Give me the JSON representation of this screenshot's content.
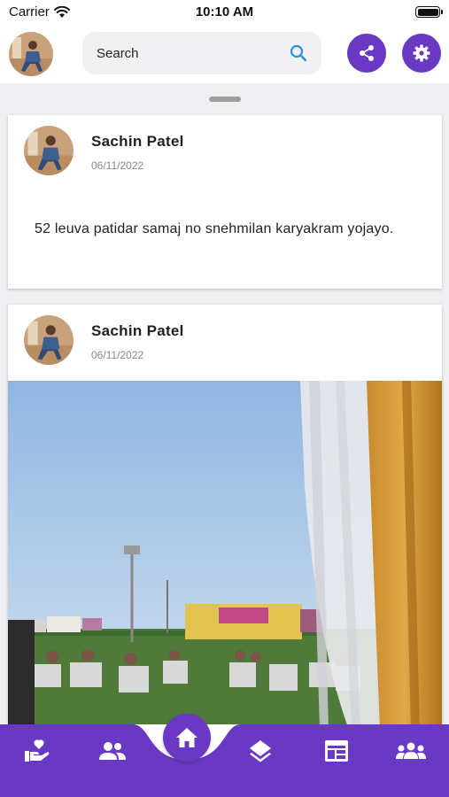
{
  "status_bar": {
    "carrier": "Carrier",
    "time": "10:10 AM"
  },
  "header": {
    "search_label": "Search",
    "share_icon": "share-icon",
    "settings_icon": "gear-icon"
  },
  "posts": [
    {
      "author": "Sachin Patel",
      "date": "06/11/2022",
      "text": "52 leuva patidar samaj no snehmilan karyakram yojayo."
    },
    {
      "author": "Sachin Patel",
      "date": "06/11/2022",
      "image": "event-ground-photo"
    }
  ],
  "bottom_nav": {
    "items": [
      "donation-icon",
      "members-icon",
      "home-icon",
      "layers-icon",
      "calendar-icon",
      "groups-icon"
    ]
  },
  "colors": {
    "accent": "#6a39c4",
    "feed_background": "#f0f0f2",
    "search_icon": "#2f8fd8"
  }
}
